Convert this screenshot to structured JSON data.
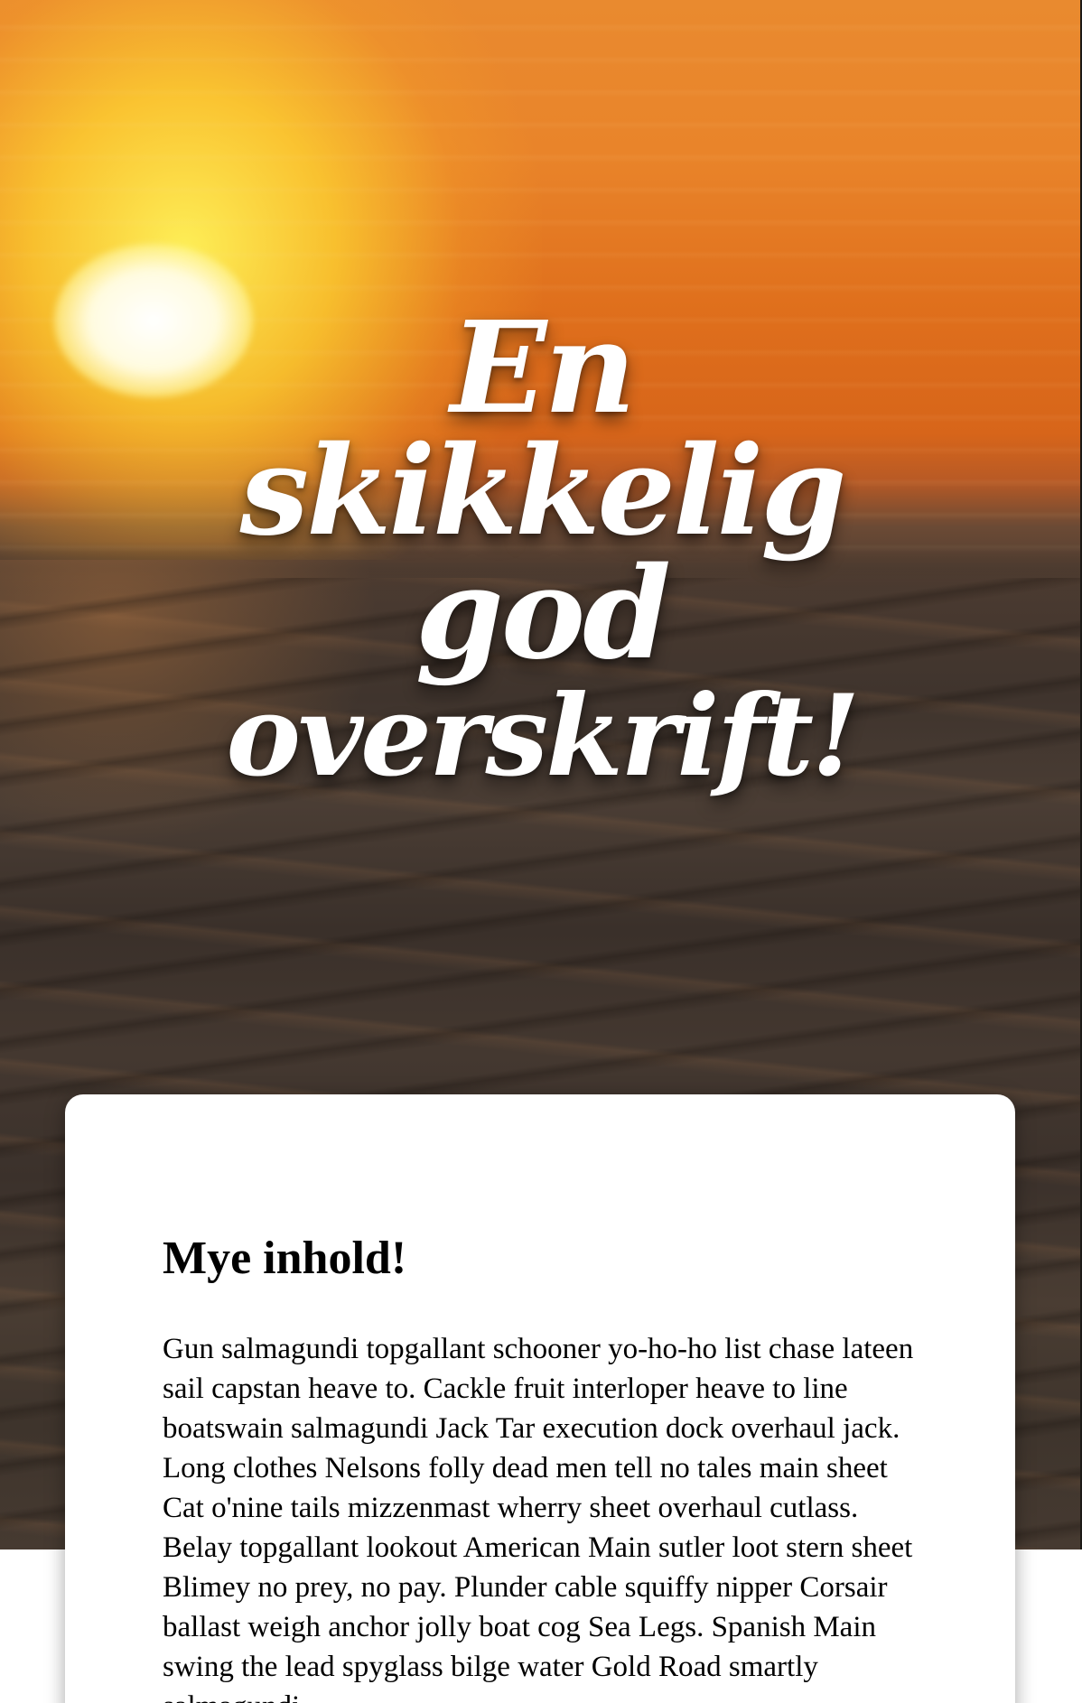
{
  "hero": {
    "image_description": "sunset-over-sea",
    "headline_lines": [
      "En",
      "skikkelig",
      "god",
      "overskrift!"
    ]
  },
  "content": {
    "title": "Mye inhold!",
    "body": "Gun salmagundi topgallant schooner yo-ho-ho list chase lateen sail capstan heave to. Cackle fruit interloper heave to line boatswain salmagundi Jack Tar execution dock overhaul jack. Long clothes Nelsons folly dead men tell no tales main sheet Cat o'nine tails mizzenmast wherry sheet overhaul cutlass. Belay topgallant lookout American Main sutler loot stern sheet Blimey no prey, no pay. Plunder cable squiffy nipper Corsair ballast weigh anchor jolly boat cog Sea Legs. Spanish Main swing the lead spyglass bilge water Gold Road smartly salmagundi"
  },
  "colors": {
    "headline_text": "#ffffff",
    "card_background": "#ffffff",
    "body_text": "#000000",
    "sky_orange": "#e98a2f",
    "sun_yellow": "#fff35a",
    "sea_dark": "#3f342d"
  }
}
